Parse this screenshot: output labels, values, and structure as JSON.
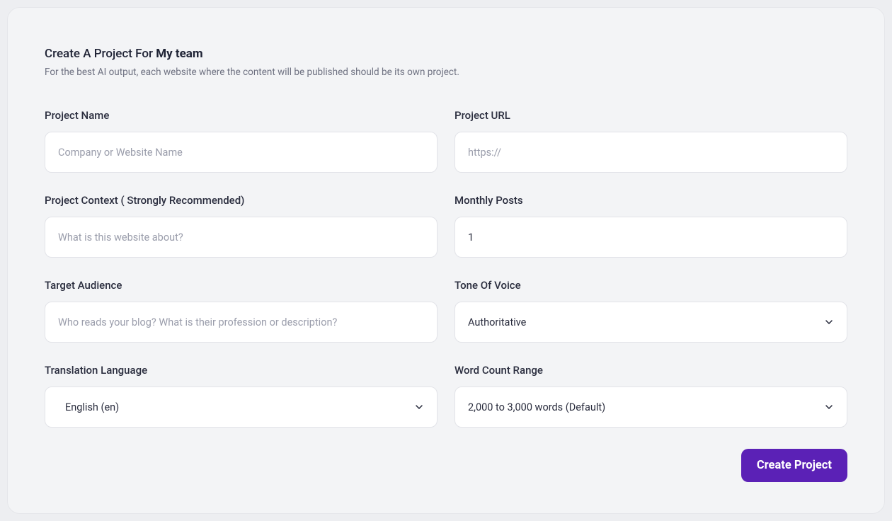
{
  "header": {
    "title_prefix": "Create A Project For ",
    "team_name": "My team",
    "subtitle": "For the best AI output, each website where the content will be published should be its own project."
  },
  "fields": {
    "project_name": {
      "label": "Project Name",
      "placeholder": "Company or Website Name",
      "value": ""
    },
    "project_url": {
      "label": "Project URL",
      "placeholder": "https://",
      "value": ""
    },
    "project_context": {
      "label": "Project Context ( Strongly Recommended)",
      "placeholder": "What is this website about?",
      "value": ""
    },
    "monthly_posts": {
      "label": "Monthly Posts",
      "value": "1"
    },
    "target_audience": {
      "label": "Target Audience",
      "placeholder": "Who reads your blog? What is their profession or description?",
      "value": ""
    },
    "tone_of_voice": {
      "label": "Tone Of Voice",
      "selected": "Authoritative"
    },
    "translation_language": {
      "label": "Translation Language",
      "selected": "English (en)"
    },
    "word_count_range": {
      "label": "Word Count Range",
      "selected": "2,000 to 3,000 words (Default)"
    }
  },
  "actions": {
    "create_label": "Create Project"
  }
}
